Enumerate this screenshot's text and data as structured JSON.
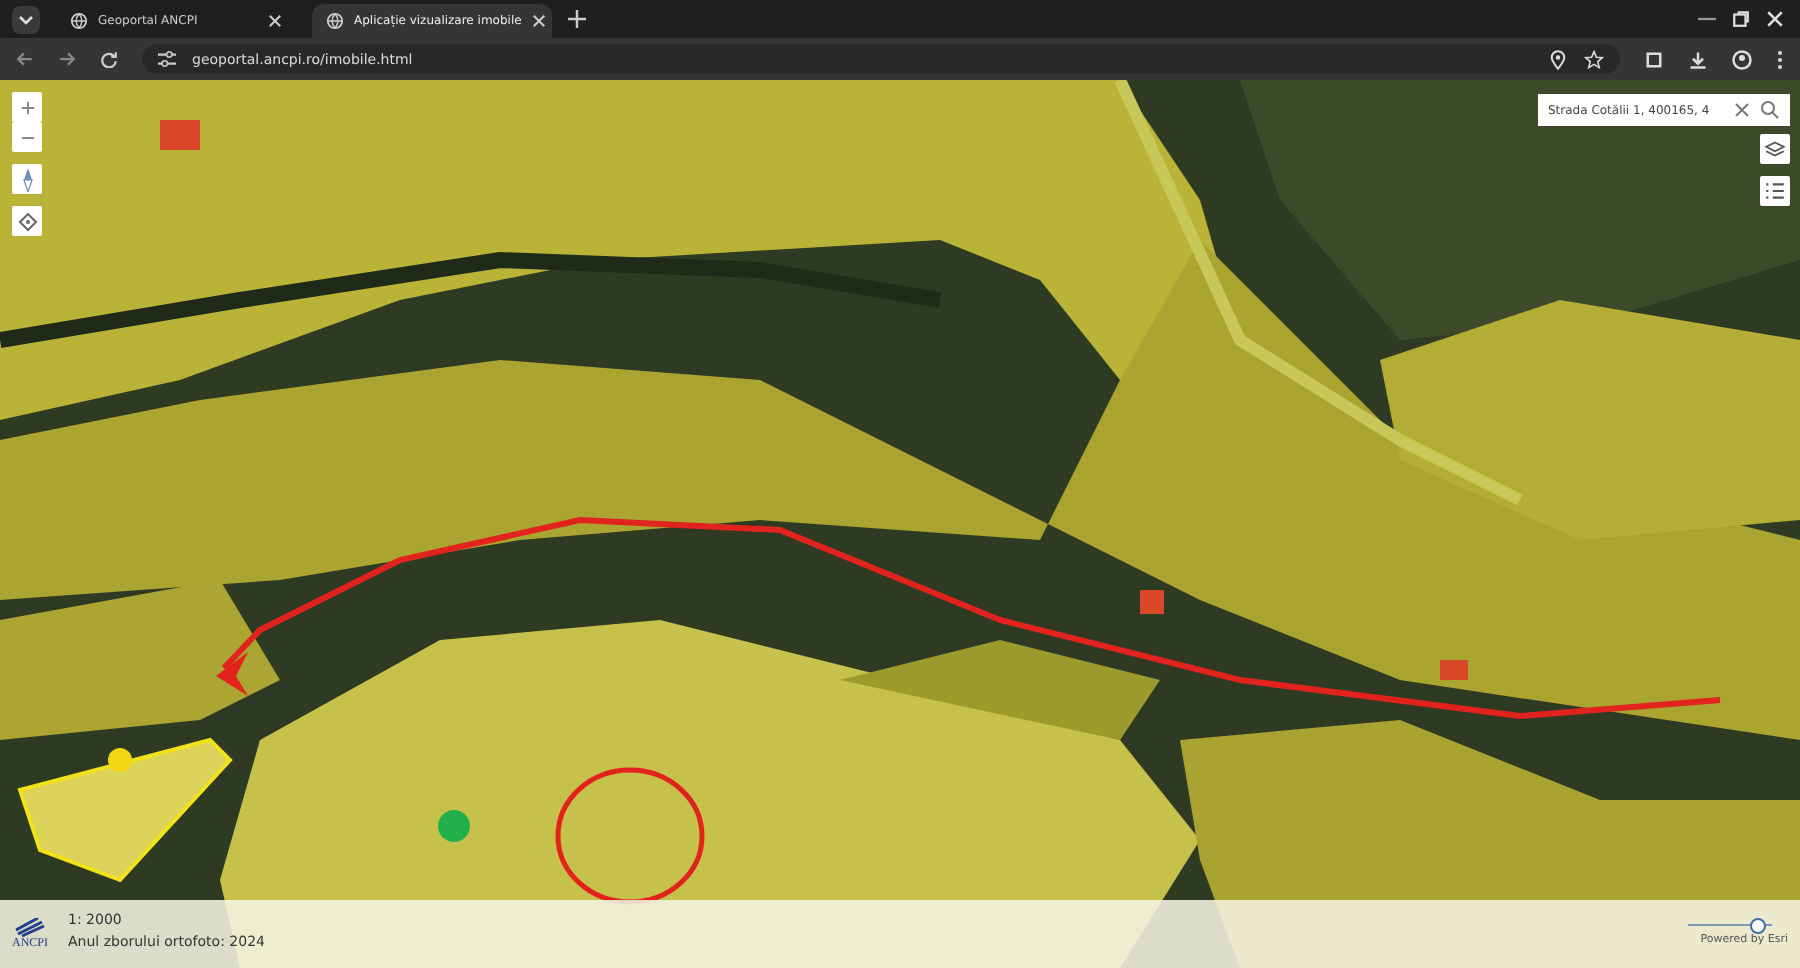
{
  "browser": {
    "tabs": [
      {
        "title": "Geoportal ANCPI",
        "selected": false
      },
      {
        "title": "Aplicație vizualizare imobile",
        "selected": true
      }
    ],
    "url": "geoportal.ancpi.ro/imobile.html"
  },
  "search": {
    "value": "Strada Cotălii 1, 400165, 4"
  },
  "footer": {
    "logo_text": "ANCPI",
    "scale": "1: 2000",
    "orthophoto_year": "Anul zborului ortofoto: 2024",
    "opacity_slider": {
      "level": 0.8
    },
    "attribution": "Powered by Esri"
  }
}
